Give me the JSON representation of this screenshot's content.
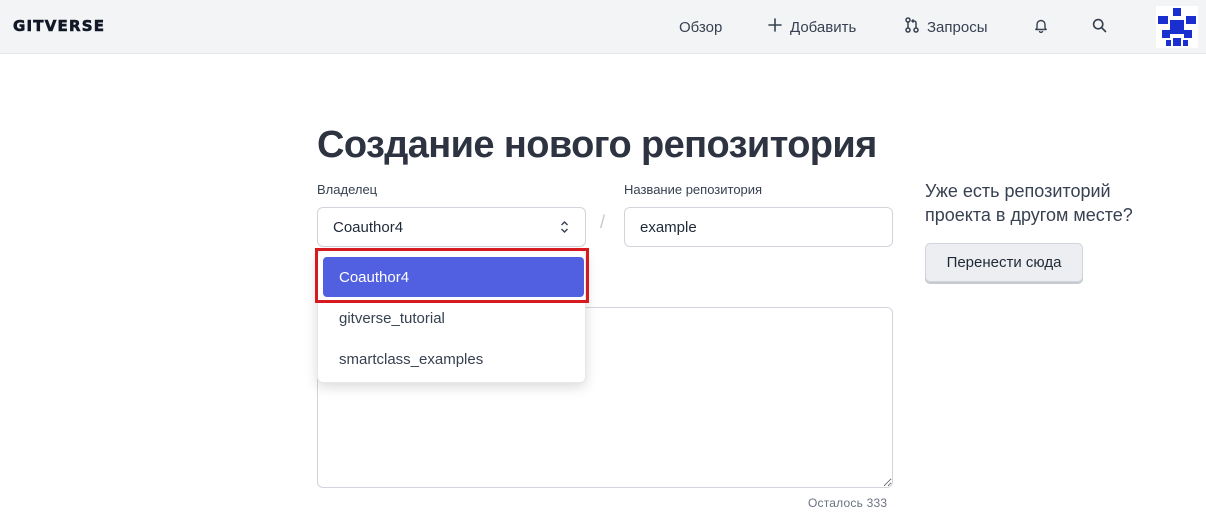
{
  "header": {
    "logo_text": "GITVERSE",
    "nav": {
      "overview": "Обзор",
      "add": "Добавить",
      "requests": "Запросы"
    },
    "icons": [
      "bell-icon",
      "search-icon",
      "plus-icon",
      "pull-request-icon"
    ]
  },
  "main": {
    "title": "Создание нового репозитория",
    "owner_label": "Владелец",
    "owner_value": "Coauthor4",
    "separator": "/",
    "repo_label": "Название репозитория",
    "repo_value": "example",
    "remaining_text": "Осталось 333"
  },
  "dropdown": {
    "options": [
      "Coauthor4",
      "gitverse_tutorial",
      "smartclass_examples"
    ],
    "selected_index": 0,
    "selected_color": "#5160e0",
    "highlight_color": "#d71920"
  },
  "side": {
    "question": "Уже есть репозиторий проекта в другом месте?",
    "migrate_button": "Перенести сюда"
  }
}
